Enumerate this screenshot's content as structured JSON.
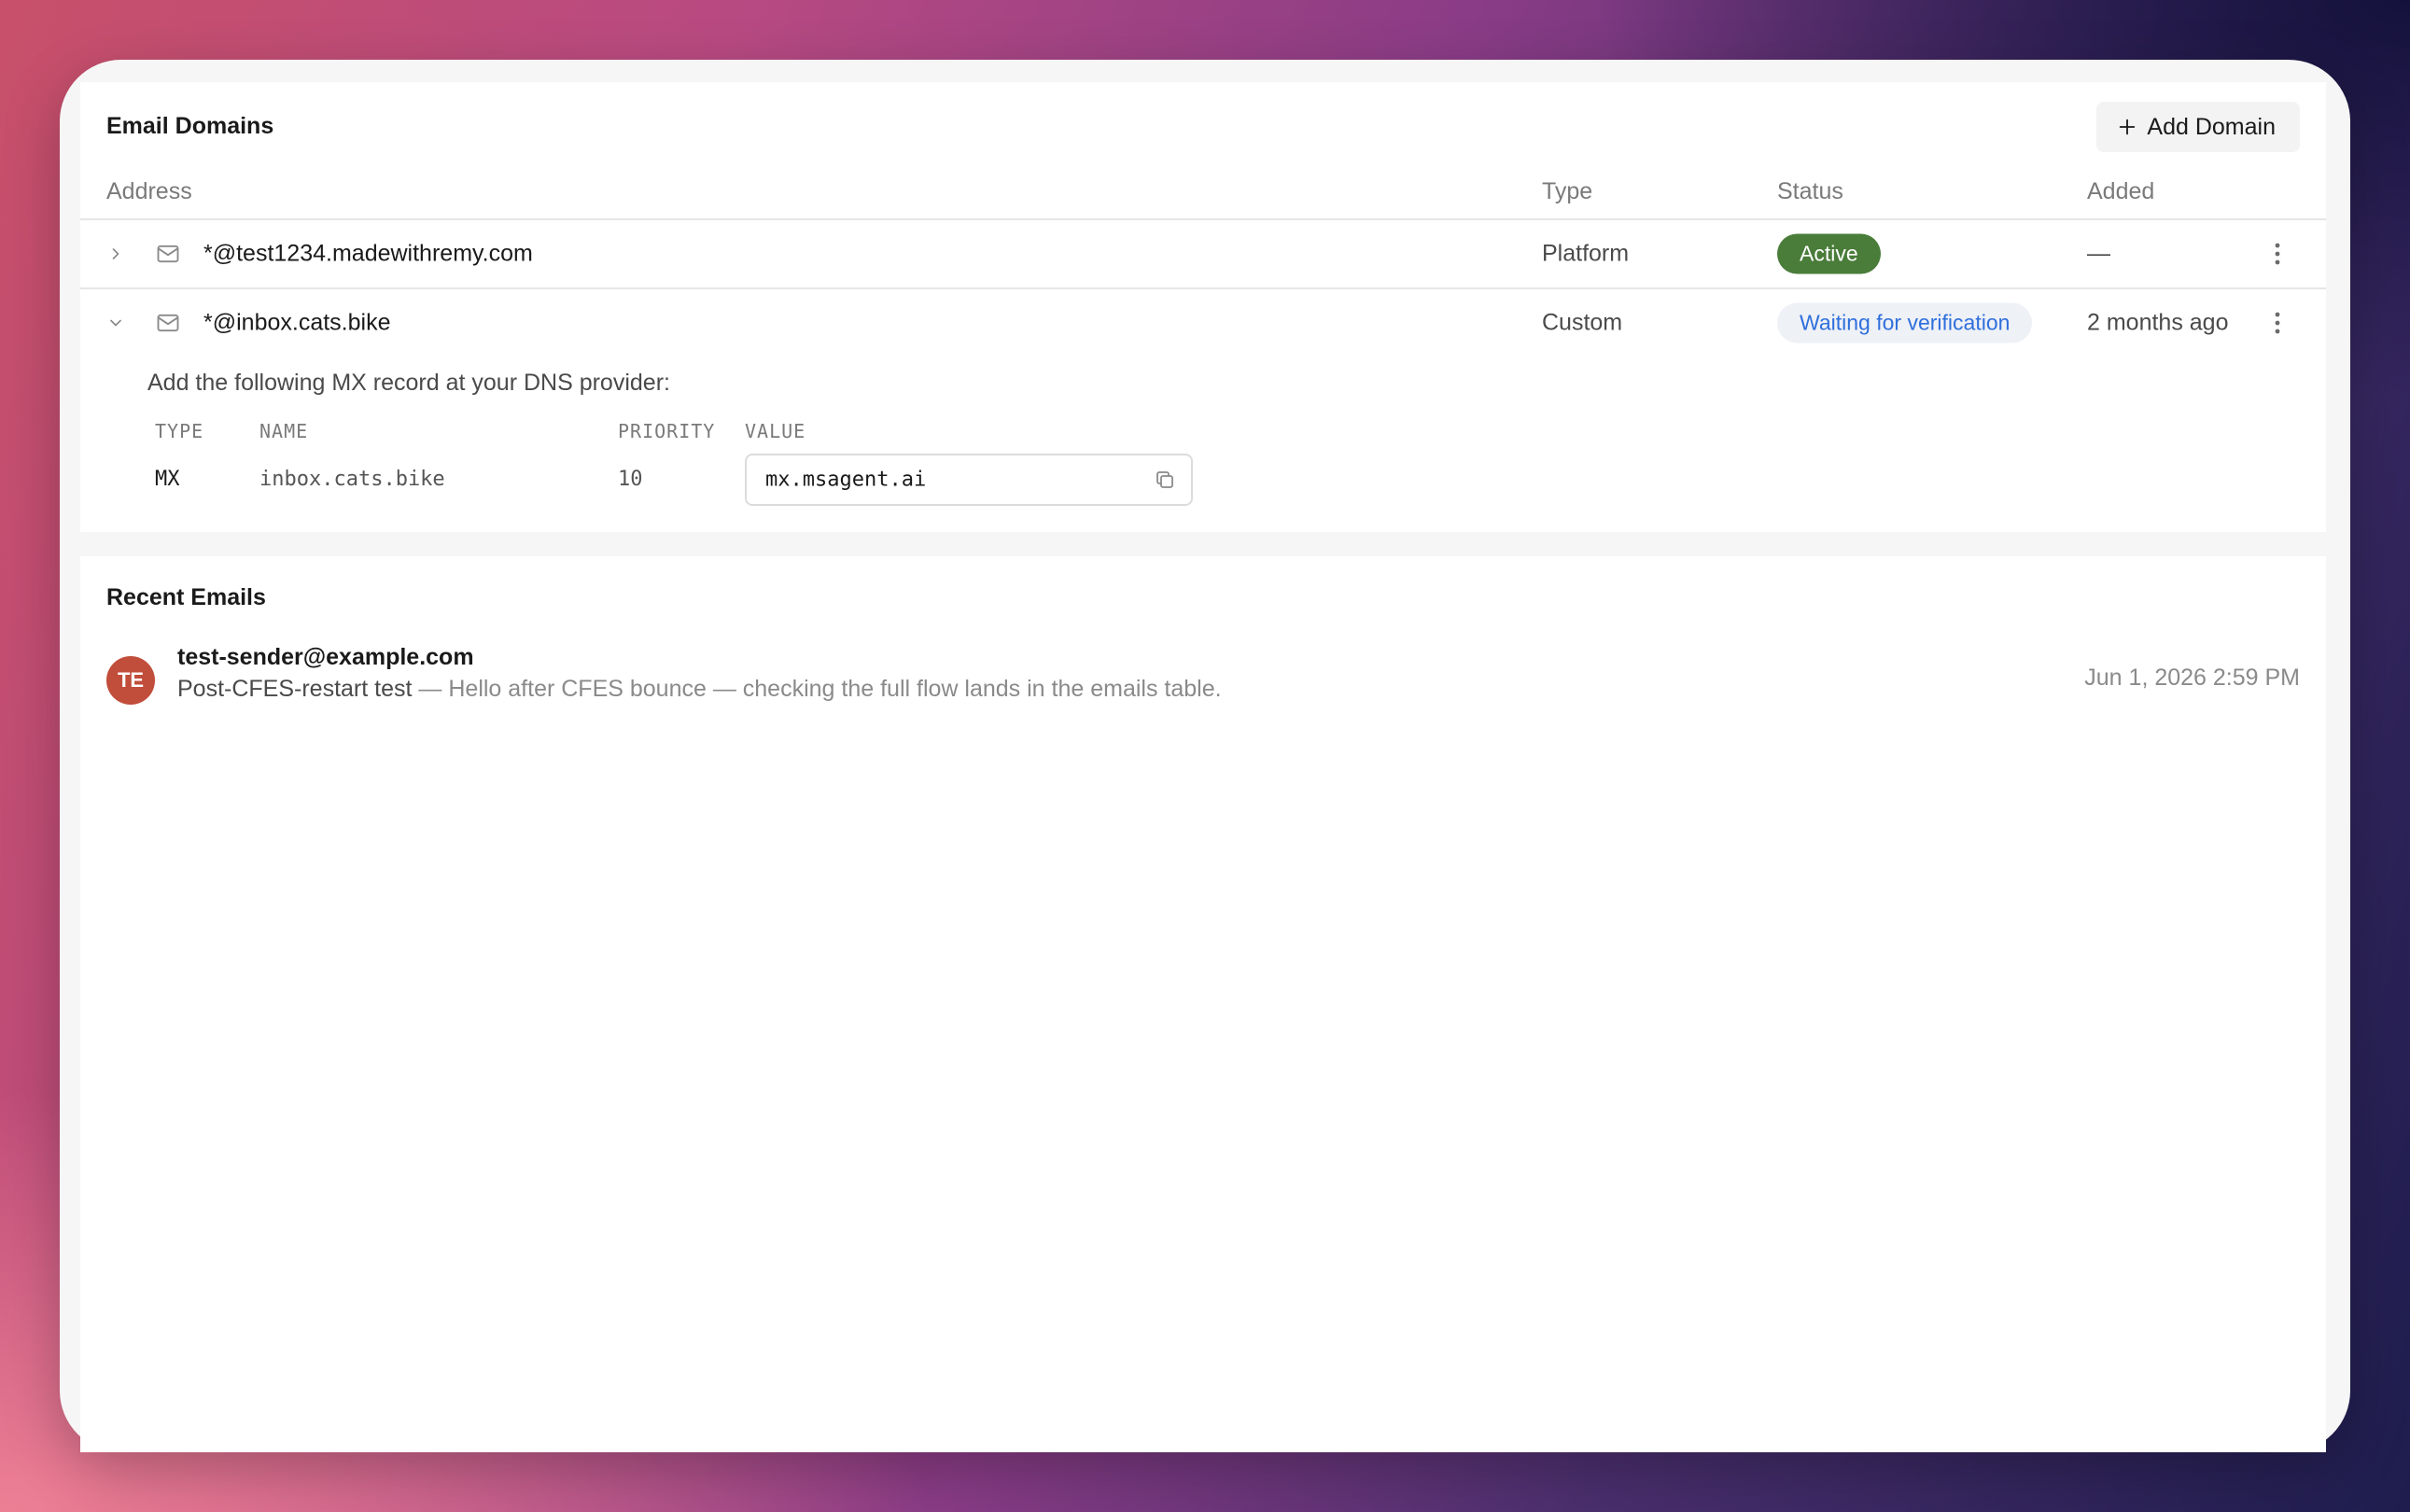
{
  "domains": {
    "title": "Email Domains",
    "add_button_label": "Add Domain",
    "columns": {
      "address": "Address",
      "type": "Type",
      "status": "Status",
      "added": "Added"
    },
    "rows": [
      {
        "address": "*@test1234.madewithremy.com",
        "type": "Platform",
        "status": "Active",
        "added": "—",
        "expanded": false
      },
      {
        "address": "*@inbox.cats.bike",
        "type": "Custom",
        "status": "Waiting for verification",
        "added": "2 months ago",
        "expanded": true,
        "dns": {
          "instruction": "Add the following MX record at your DNS provider:",
          "headers": {
            "type": "TYPE",
            "name": "NAME",
            "priority": "PRIORITY",
            "value": "VALUE"
          },
          "record": {
            "type": "MX",
            "name": "inbox.cats.bike",
            "priority": "10",
            "value": "mx.msagent.ai"
          }
        }
      }
    ]
  },
  "recent_emails": {
    "title": "Recent Emails",
    "items": [
      {
        "avatar_initials": "TE",
        "sender": "test-sender@example.com",
        "subject": "Post-CFES-restart test",
        "separator": " — ",
        "preview": "Hello after CFES bounce — checking the full flow lands in the emails table.",
        "date": "Jun 1, 2026 2:59 PM"
      }
    ]
  },
  "colors": {
    "active_badge": "#4a7c3a",
    "waiting_badge_text": "#2f6fdc",
    "waiting_badge_bg": "#eef1f6",
    "avatar": "#c14d3b"
  },
  "icons": [
    "plus-icon",
    "chevron-right-icon",
    "chevron-down-icon",
    "mail-icon",
    "more-vertical-icon",
    "copy-icon"
  ]
}
